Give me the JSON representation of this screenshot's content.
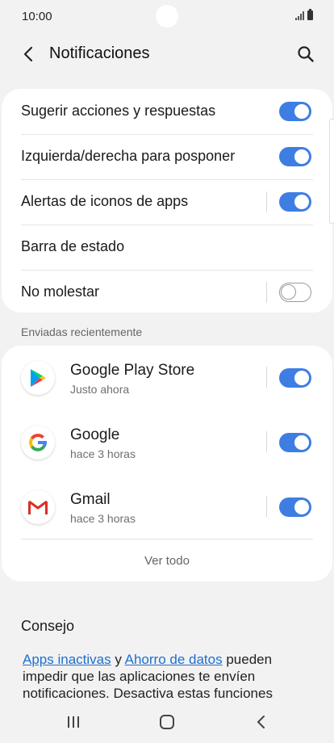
{
  "status_bar": {
    "time": "10:00"
  },
  "header": {
    "title": "Notificaciones"
  },
  "settings": [
    {
      "label": "Sugerir acciones y respuestas",
      "toggle": "on",
      "divider": false
    },
    {
      "label": "Izquierda/derecha para posponer",
      "toggle": "on",
      "divider": false
    },
    {
      "label": "Alertas de iconos de apps",
      "toggle": "on",
      "divider": true
    },
    {
      "label": "Barra de estado",
      "toggle": null,
      "divider": false
    },
    {
      "label": "No molestar",
      "toggle": "off",
      "divider": true
    }
  ],
  "recent": {
    "section_label": "Enviadas recientemente",
    "apps": [
      {
        "name": "Google Play Store",
        "time": "Justo ahora",
        "icon": "play-store-icon",
        "toggle": "on"
      },
      {
        "name": "Google",
        "time": "hace 3 horas",
        "icon": "google-icon",
        "toggle": "on"
      },
      {
        "name": "Gmail",
        "time": "hace 3 horas",
        "icon": "gmail-icon",
        "toggle": "on"
      }
    ],
    "see_all": "Ver todo"
  },
  "tip": {
    "title": "Consejo",
    "link1": "Apps inactivas",
    "connector": " y ",
    "link2": "Ahorro de datos",
    "text": " pueden impedir que las aplicaciones te envíen notificaciones. Desactiva estas funciones"
  },
  "colors": {
    "accent": "#3e7ee3",
    "link": "#1f6fd0",
    "background": "#f2f2f2"
  }
}
